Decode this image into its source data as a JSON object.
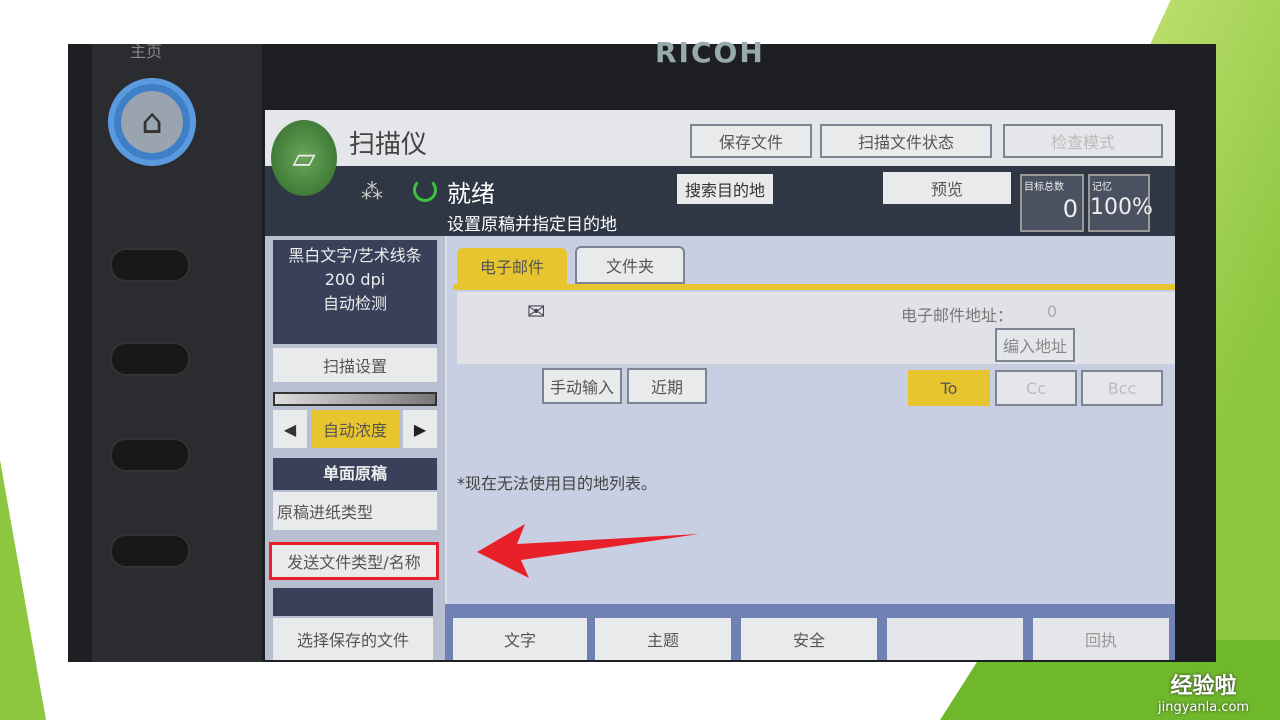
{
  "device": {
    "home_label": "主页",
    "brand": "RICOH"
  },
  "header": {
    "title": "扫描仪",
    "buttons": [
      "保存文件",
      "扫描文件状态",
      "检查模式"
    ]
  },
  "status": {
    "state": "就绪",
    "message": "设置原稿并指定目的地",
    "search_dest": "搜索目的地",
    "preview": "预览",
    "counter_label": "目标总数",
    "counter_value": "0",
    "memory_label": "记忆",
    "memory_value": "100%"
  },
  "left": {
    "scan_summary": [
      "黑白文字/艺术线条",
      "200 dpi",
      "自动检测"
    ],
    "scan_settings": "扫描设置",
    "density": "自动浓度",
    "original_sides": "单面原稿",
    "feed_type": "原稿进纸类型",
    "send_file_type": "发送文件类型/名称",
    "select_stored": "选择保存的文件"
  },
  "tabs": [
    {
      "label": "电子邮件",
      "active": true
    },
    {
      "label": "文件夹",
      "active": false
    }
  ],
  "email": {
    "address_label": "电子邮件地址：",
    "address_count": "0",
    "enter_address": "编入地址",
    "manual_input": "手动输入",
    "recent": "近期",
    "to": "To",
    "cc": "Cc",
    "bcc": "Bcc",
    "notice": "*现在无法使用目的地列表。"
  },
  "bottom_tabs": [
    "文字",
    "主题",
    "安全",
    "",
    "回执"
  ],
  "watermark": {
    "cn": "经验啦",
    "url": "jingyanla.com"
  },
  "colors": {
    "accent_yellow": "#e7c52f",
    "highlight_red": "#e8202a",
    "slide_green": "#8dc63f"
  }
}
